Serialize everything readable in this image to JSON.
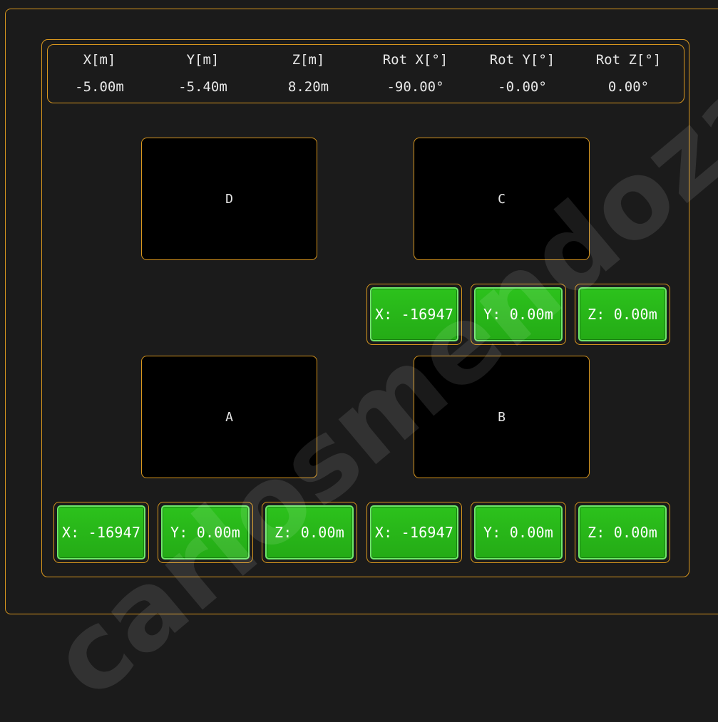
{
  "readout": {
    "columns": [
      {
        "label": "X[m]",
        "value": "-5.00m"
      },
      {
        "label": "Y[m]",
        "value": "-5.40m"
      },
      {
        "label": "Z[m]",
        "value": "8.20m"
      },
      {
        "label": "Rot X[°]",
        "value": "-90.00°"
      },
      {
        "label": "Rot Y[°]",
        "value": "-0.00°"
      },
      {
        "label": "Rot Z[°]",
        "value": "0.00°"
      }
    ]
  },
  "zones": {
    "d": "D",
    "c": "C",
    "a": "A",
    "b": "B"
  },
  "mid_buttons": {
    "x": "X: -16947",
    "y": "Y: 0.00m",
    "z": "Z: 0.00m"
  },
  "bottom_buttons": [
    "X: -16947",
    "Y: 0.00m",
    "Z: 0.00m",
    "X: -16947",
    "Y: 0.00m",
    "Z: 0.00m"
  ],
  "watermark": "carlosmendoza.co",
  "colors": {
    "accent_border": "#d9971e",
    "button_green": "#2cc21c",
    "background": "#1b1b1b",
    "zone_fill": "#000000"
  }
}
